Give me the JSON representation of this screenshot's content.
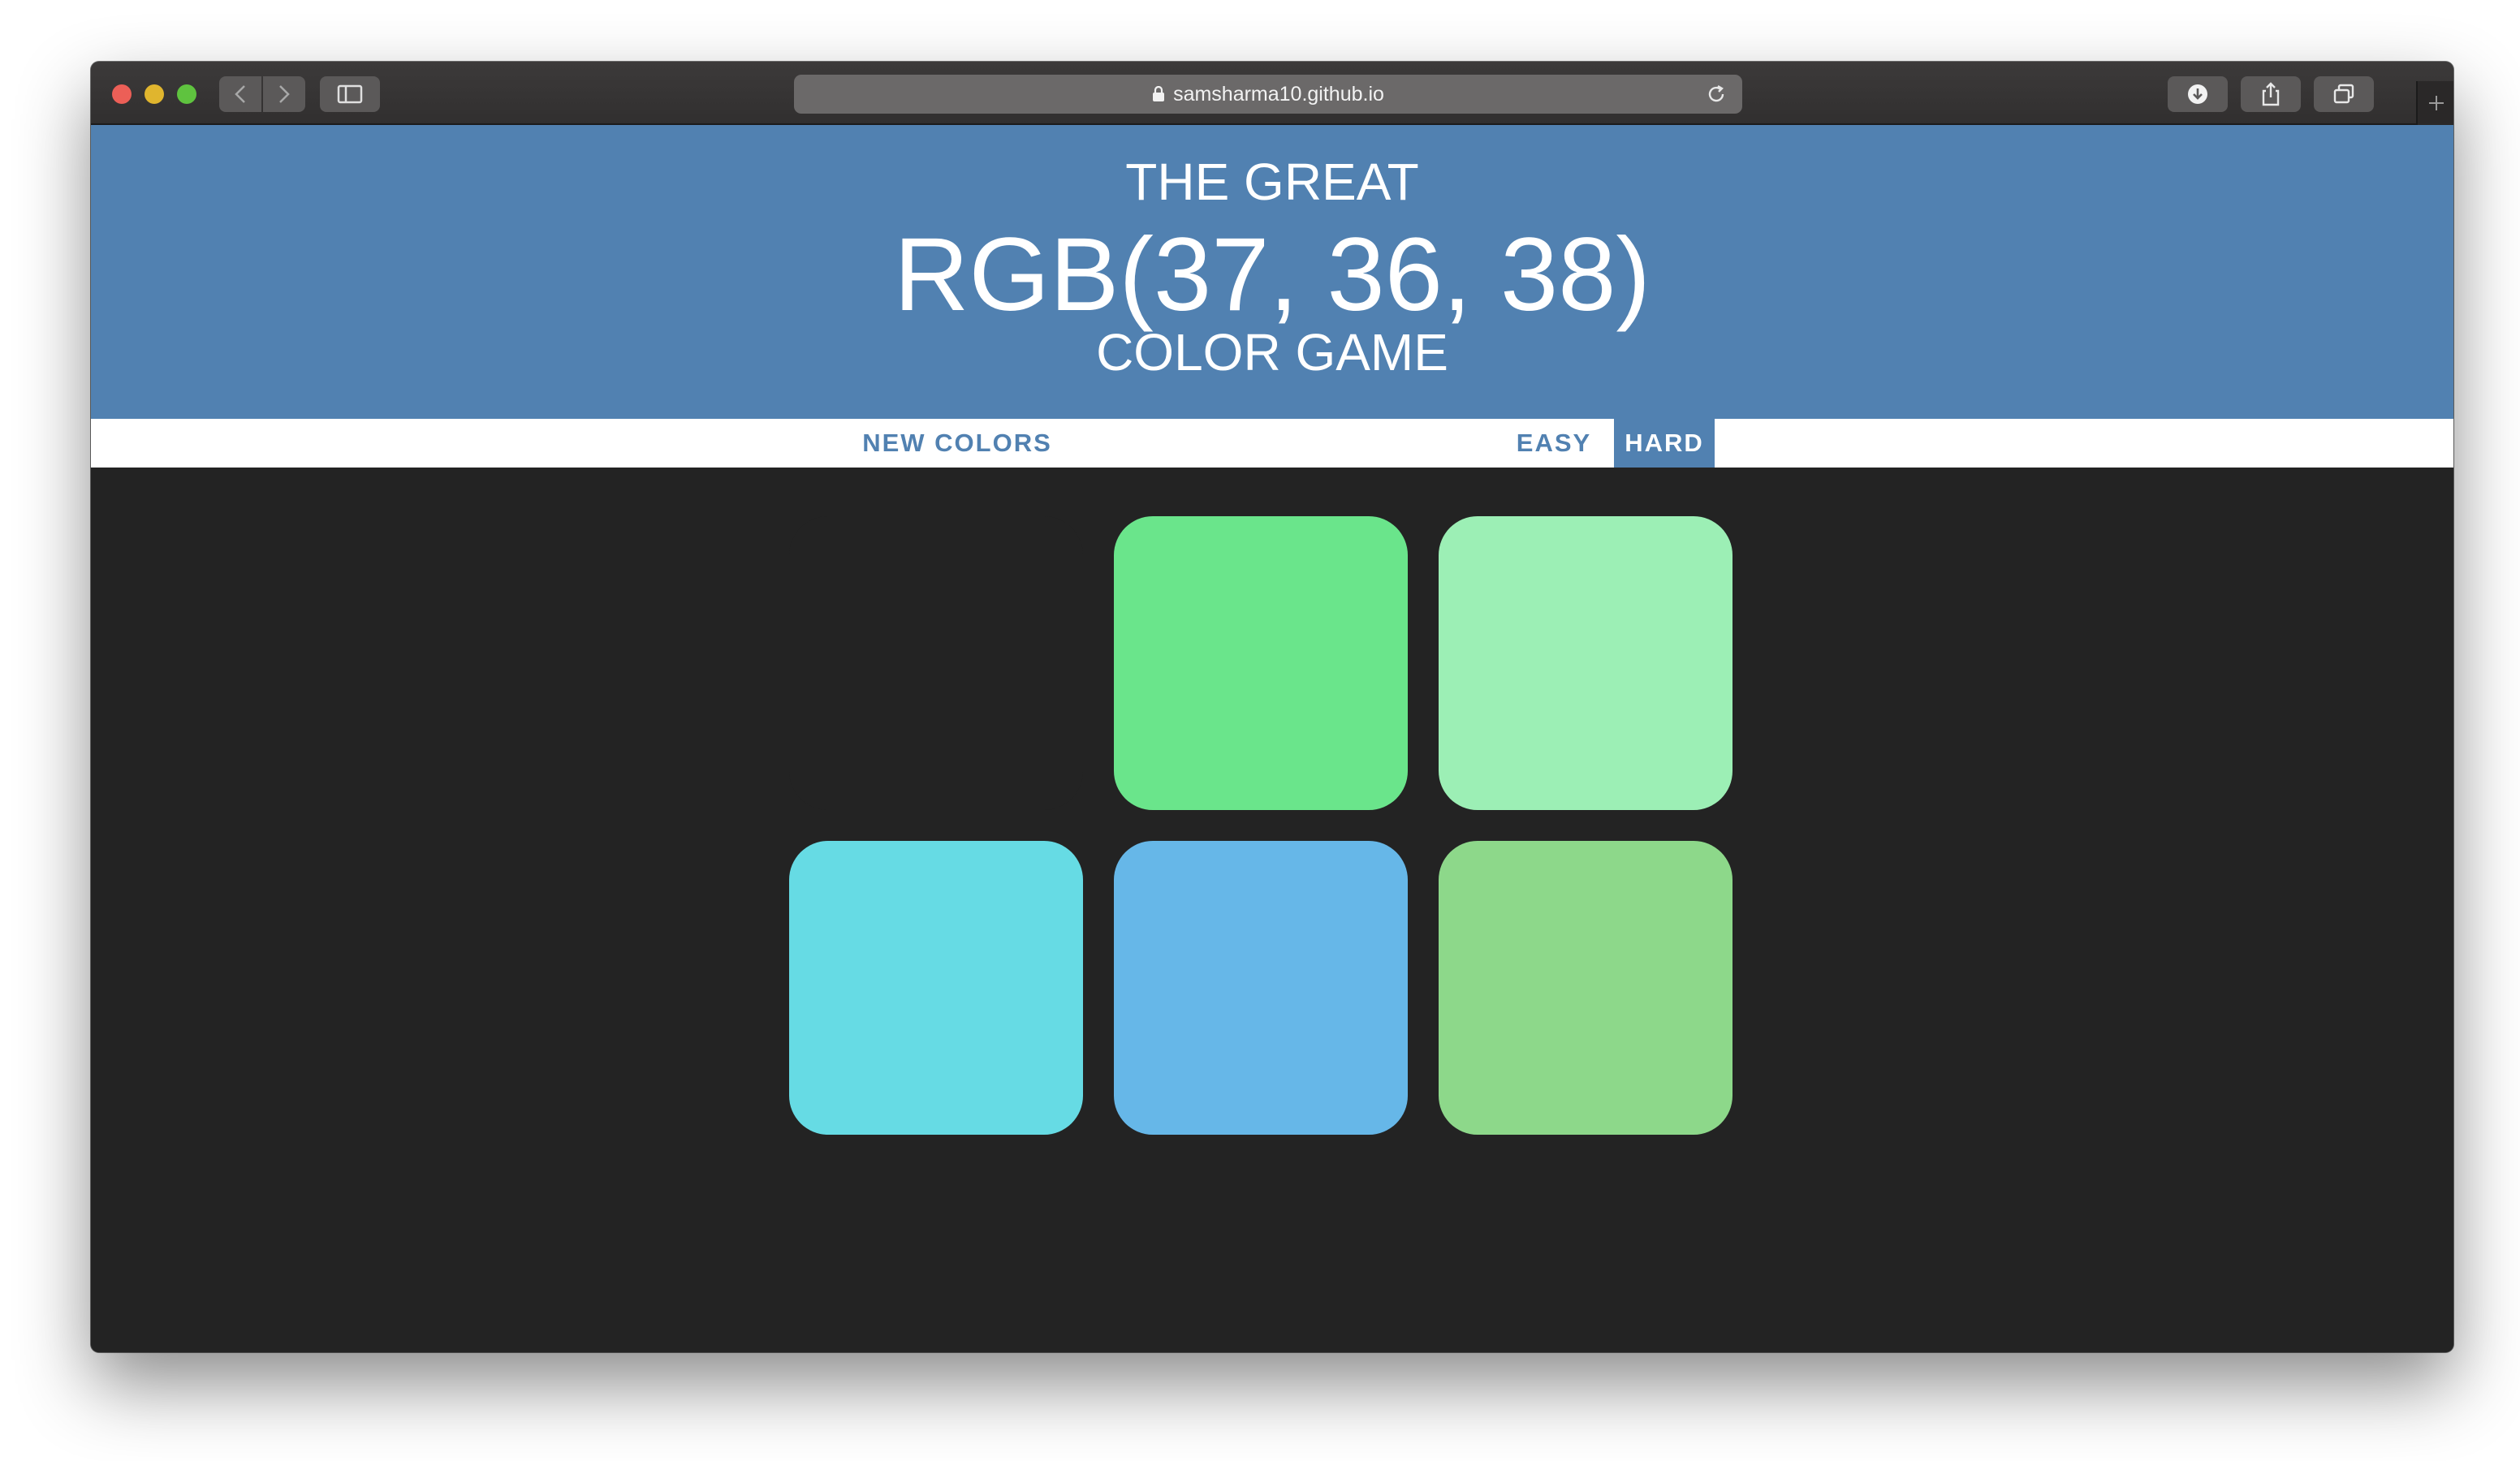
{
  "browser": {
    "url": "samsharma10.github.io"
  },
  "header": {
    "line1": "THE GREAT",
    "rgb_display": "RGB(37, 36, 38)",
    "line3": "COLOR GAME",
    "background": "#5181b1"
  },
  "stripe": {
    "new_colors_label": "NEW COLORS",
    "easy_label": "EASY",
    "hard_label": "HARD",
    "selected_mode": "HARD"
  },
  "board": {
    "background": "#232323",
    "squares": [
      {
        "color": "#232323",
        "state": "hidden"
      },
      {
        "color": "#6ae58b"
      },
      {
        "color": "#9cefb5"
      },
      {
        "color": "#66dbe4"
      },
      {
        "color": "#66b7e8"
      },
      {
        "color": "#8dd88a"
      }
    ]
  }
}
